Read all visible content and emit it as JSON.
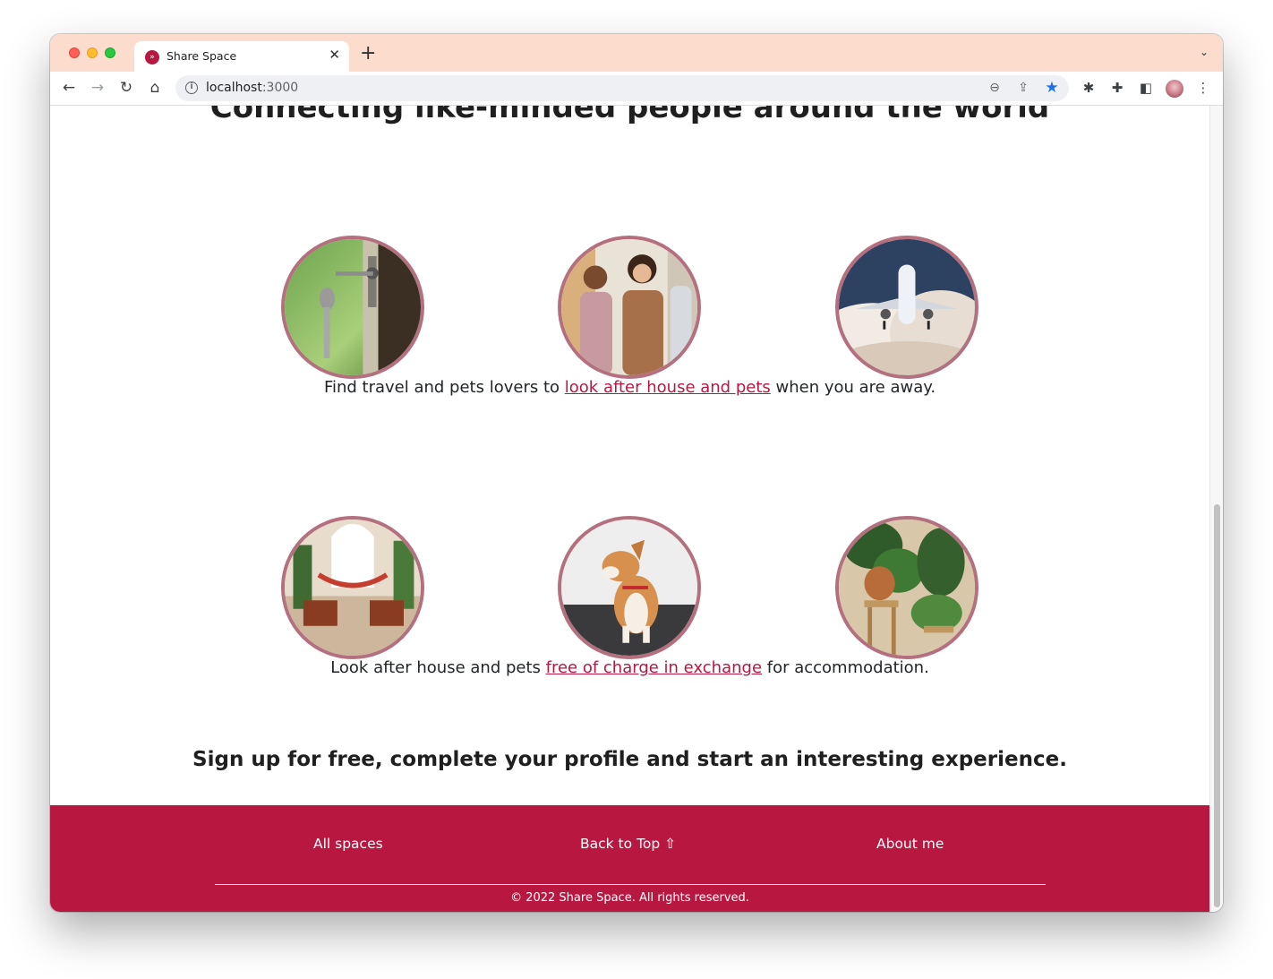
{
  "browser": {
    "tab_title": "Share Space",
    "url_host": "localhost",
    "url_port": ":3000"
  },
  "page": {
    "heading": "Connecting like-minded people around the world",
    "row1_images": [
      "house-key-image",
      "people-meeting-image",
      "airplane-image"
    ],
    "caption1": {
      "before": "Find travel and pets lovers to ",
      "link": "look after house and pets",
      "after": " when you are away."
    },
    "row2_images": [
      "living-room-image",
      "corgi-dog-image",
      "house-plants-image"
    ],
    "caption2": {
      "before": "Look after house and pets ",
      "link": "free of charge in exchange",
      "after": " for accommodation."
    },
    "signup_text": "Sign up for free, complete your profile and start an interesting experience."
  },
  "footer": {
    "all_spaces": "All spaces",
    "back_to_top": "Back to Top ⇧",
    "about_me": "About me",
    "copyright": "© 2022 Share Space. All rights reserved."
  },
  "colors": {
    "brand": "#b8173f",
    "circle_border": "#b5707f",
    "titlebar": "#fcdccd"
  }
}
